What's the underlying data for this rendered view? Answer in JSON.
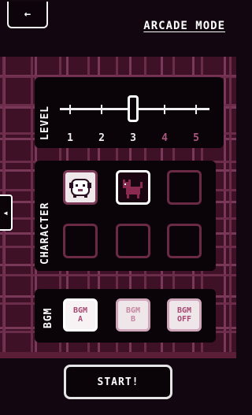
{
  "header": {
    "back_glyph": "←",
    "title": "ARCADE MODE"
  },
  "level": {
    "label": "LEVEL",
    "selected": 3,
    "options": [
      "1",
      "2",
      "3",
      "4",
      "5"
    ]
  },
  "character": {
    "label": "CHARACTER",
    "slots": [
      "ghost-dog",
      "cat",
      "empty",
      "empty",
      "empty",
      "empty"
    ],
    "selected_index": 1
  },
  "bgm": {
    "label": "BGM",
    "options": [
      {
        "line1": "BGM",
        "line2": "A"
      },
      {
        "line1": "BGM",
        "line2": "B"
      },
      {
        "line1": "BGM",
        "line2": "OFF"
      }
    ],
    "selected_index": 0
  },
  "side_tab_glyph": "◀",
  "start_label": "START!",
  "colors": {
    "background": "#120610",
    "board": "#3f1126",
    "accent": "#6a2a44",
    "bgm_text": "#a64a72"
  }
}
